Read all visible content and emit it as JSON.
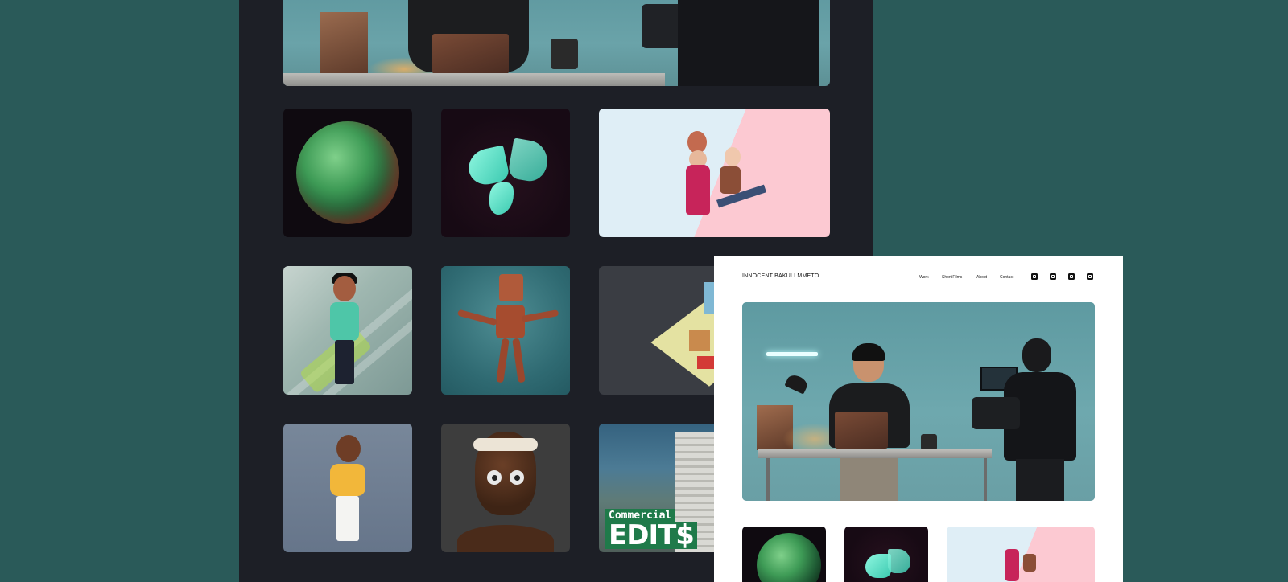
{
  "site": {
    "brand": "INNOCENT BAKULI MMETO",
    "nav": [
      "Work",
      "Short Films",
      "About",
      "Contact"
    ],
    "social_icons": [
      "mail-icon",
      "twitter-icon",
      "instagram-icon",
      "youtube-icon"
    ]
  },
  "gallery": {
    "tiles": [
      {
        "name": "hero-film-set-image"
      },
      {
        "name": "green-planet-image"
      },
      {
        "name": "butterfly-image"
      },
      {
        "name": "proposal-illustration-image"
      },
      {
        "name": "boy-with-phone-illustration"
      },
      {
        "name": "robot-render-image"
      },
      {
        "name": "isometric-city-image"
      },
      {
        "name": "boy-yellow-sweater-illustration"
      },
      {
        "name": "3d-face-render-image"
      },
      {
        "name": "commercial-edits-image"
      }
    ],
    "commercial_line1": "Commercial",
    "commercial_line2": "EDIT$"
  },
  "colors": {
    "background": "#2a5a59",
    "dark_page": "#1d1f26",
    "preview_page": "#ffffff"
  }
}
